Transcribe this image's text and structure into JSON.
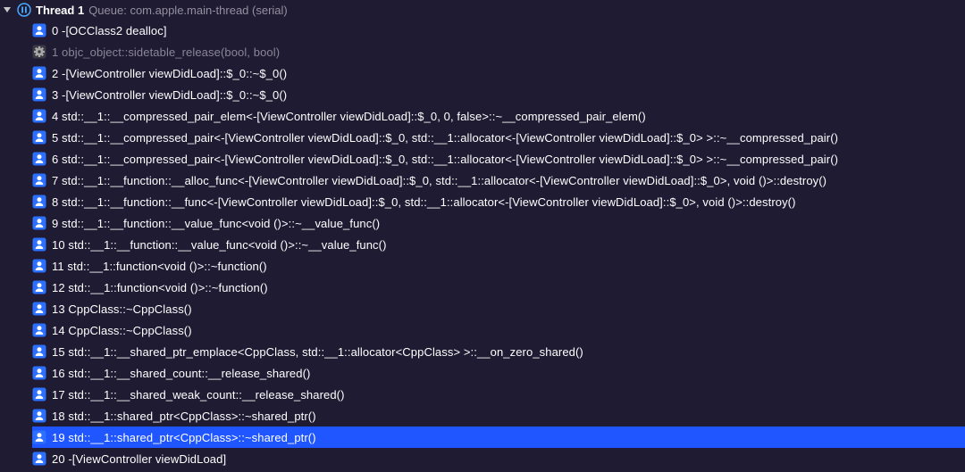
{
  "thread": {
    "title": "Thread 1",
    "queue_label": "Queue: com.apple.main-thread (serial)"
  },
  "frames": [
    {
      "idx": "0",
      "kind": "user",
      "label": "-[OCClass2 dealloc]"
    },
    {
      "idx": "1",
      "kind": "sys",
      "label": "objc_object::sidetable_release(bool, bool)"
    },
    {
      "idx": "2",
      "kind": "user",
      "label": "-[ViewController viewDidLoad]::$_0::~$_0()"
    },
    {
      "idx": "3",
      "kind": "user",
      "label": "-[ViewController viewDidLoad]::$_0::~$_0()"
    },
    {
      "idx": "4",
      "kind": "user",
      "label": "std::__1::__compressed_pair_elem<-[ViewController viewDidLoad]::$_0, 0, false>::~__compressed_pair_elem()"
    },
    {
      "idx": "5",
      "kind": "user",
      "label": "std::__1::__compressed_pair<-[ViewController viewDidLoad]::$_0, std::__1::allocator<-[ViewController viewDidLoad]::$_0> >::~__compressed_pair()"
    },
    {
      "idx": "6",
      "kind": "user",
      "label": "std::__1::__compressed_pair<-[ViewController viewDidLoad]::$_0, std::__1::allocator<-[ViewController viewDidLoad]::$_0> >::~__compressed_pair()"
    },
    {
      "idx": "7",
      "kind": "user",
      "label": "std::__1::__function::__alloc_func<-[ViewController viewDidLoad]::$_0, std::__1::allocator<-[ViewController viewDidLoad]::$_0>, void ()>::destroy()"
    },
    {
      "idx": "8",
      "kind": "user",
      "label": "std::__1::__function::__func<-[ViewController viewDidLoad]::$_0, std::__1::allocator<-[ViewController viewDidLoad]::$_0>, void ()>::destroy()"
    },
    {
      "idx": "9",
      "kind": "user",
      "label": "std::__1::__function::__value_func<void ()>::~__value_func()"
    },
    {
      "idx": "10",
      "kind": "user",
      "label": "std::__1::__function::__value_func<void ()>::~__value_func()"
    },
    {
      "idx": "11",
      "kind": "user",
      "label": "std::__1::function<void ()>::~function()"
    },
    {
      "idx": "12",
      "kind": "user",
      "label": "std::__1::function<void ()>::~function()"
    },
    {
      "idx": "13",
      "kind": "user",
      "label": "CppClass::~CppClass()"
    },
    {
      "idx": "14",
      "kind": "user",
      "label": "CppClass::~CppClass()"
    },
    {
      "idx": "15",
      "kind": "user",
      "label": "std::__1::__shared_ptr_emplace<CppClass, std::__1::allocator<CppClass> >::__on_zero_shared()"
    },
    {
      "idx": "16",
      "kind": "user",
      "label": "std::__1::__shared_count::__release_shared()"
    },
    {
      "idx": "17",
      "kind": "user",
      "label": "std::__1::__shared_weak_count::__release_shared()"
    },
    {
      "idx": "18",
      "kind": "user",
      "label": "std::__1::shared_ptr<CppClass>::~shared_ptr()"
    },
    {
      "idx": "19",
      "kind": "user",
      "label": "std::__1::shared_ptr<CppClass>::~shared_ptr()",
      "selected": true
    },
    {
      "idx": "20",
      "kind": "user",
      "label": "-[ViewController viewDidLoad]"
    }
  ]
}
